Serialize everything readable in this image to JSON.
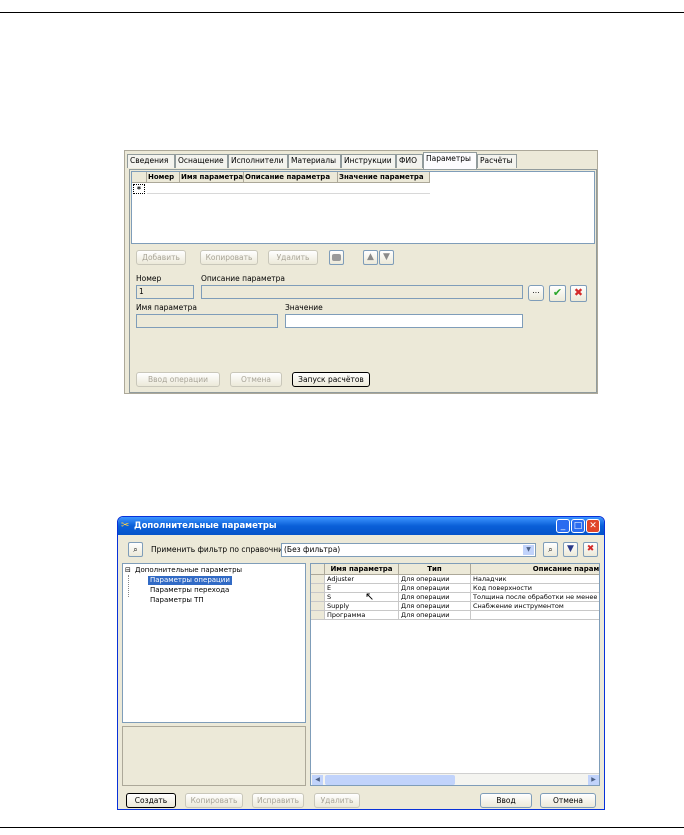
{
  "form1": {
    "tabs": [
      "Сведения",
      "Оснащение",
      "Исполнители",
      "Материалы",
      "Инструкции",
      "ФИО",
      "Параметры",
      "Расчёты"
    ],
    "active_tab": "Параметры",
    "grid_columns": [
      "Номер",
      "Имя параметра",
      "Описание параметра",
      "Значение параметра"
    ],
    "new_row_marker": "*",
    "buttons": {
      "add": "Добавить",
      "copy": "Копировать",
      "delete": "Удалить"
    },
    "fields": {
      "number_label": "Номер",
      "number_value": "1",
      "description_label": "Описание параметра",
      "description_value": "",
      "browse_label": "...",
      "name_label": "Имя параметра",
      "name_value": "",
      "value_label": "Значение",
      "value_value": ""
    },
    "footer": {
      "enter": "Ввод операции",
      "cancel": "Отмена",
      "run": "Запуск расчётов"
    }
  },
  "win2": {
    "title": "Дополнительные параметры",
    "filter_label": "Применить фильтр по справочнику:",
    "filter_value": "(Без фильтра)",
    "tree": {
      "root": "Дополнительные параметры",
      "expander": "⊟",
      "children": [
        "Параметры операции",
        "Параметры перехода",
        "Параметры ТП"
      ],
      "selected": "Параметры операции"
    },
    "table": {
      "columns": [
        "Имя параметра",
        "Тип",
        "Описание парамет"
      ],
      "rows": [
        [
          "Adjuster",
          "Для операции",
          "Наладчик"
        ],
        [
          "E",
          "Для операции",
          "Код поверхности"
        ],
        [
          "S",
          "Для операции",
          "Толщина после обработки не менее"
        ],
        [
          "Supply",
          "Для операции",
          "Снабжение инструментом"
        ],
        [
          "Программа",
          "Для операции",
          ""
        ]
      ]
    },
    "buttons": {
      "create": "Создать",
      "copy": "Копировать",
      "edit": "Исправить",
      "delete": "Удалить",
      "ok": "Ввод",
      "cancel": "Отмена"
    }
  },
  "colors": {
    "title_bar": "#0a5fd8",
    "selection": "#316ac5",
    "ok_check": "#2aa62a",
    "cancel_x": "#d42a2a"
  }
}
